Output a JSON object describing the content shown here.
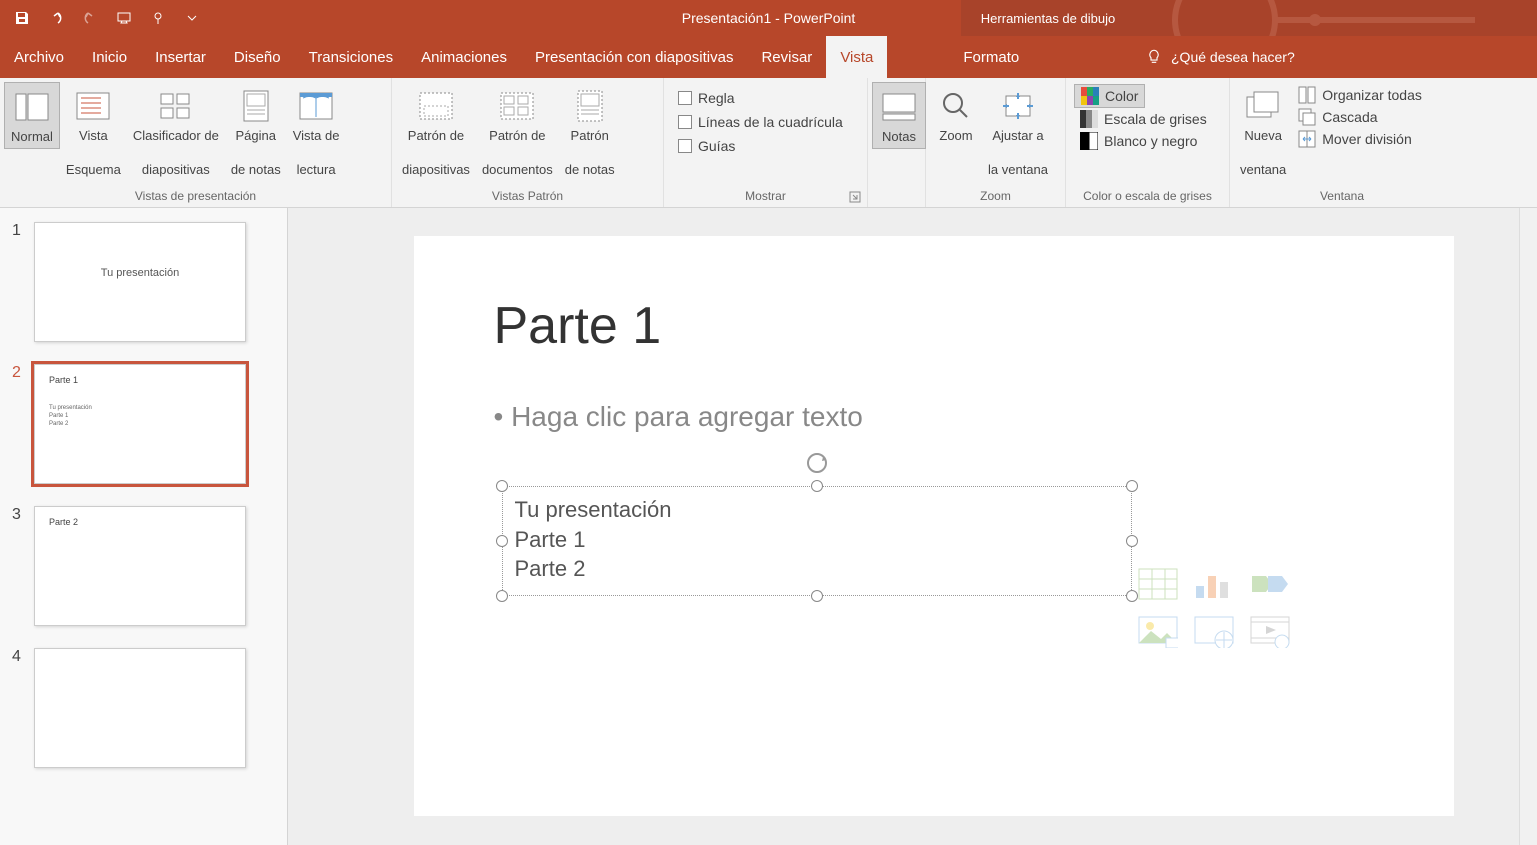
{
  "title": "Presentación1 - PowerPoint",
  "contextualTab": "Herramientas de dibujo",
  "tellMe": "¿Qué desea hacer?",
  "tabs": {
    "archivo": "Archivo",
    "inicio": "Inicio",
    "insertar": "Insertar",
    "diseno": "Diseño",
    "transiciones": "Transiciones",
    "animaciones": "Animaciones",
    "presentacion": "Presentación con diapositivas",
    "revisar": "Revisar",
    "vista": "Vista",
    "formato": "Formato"
  },
  "ribbon": {
    "vistasPresentacion": {
      "label": "Vistas de presentación",
      "normal": "Normal",
      "vistaEsquema1": "Vista",
      "vistaEsquema2": "Esquema",
      "clasificador1": "Clasificador de",
      "clasificador2": "diapositivas",
      "pagina1": "Página",
      "pagina2": "de notas",
      "vistaLectura1": "Vista de",
      "vistaLectura2": "lectura"
    },
    "vistasPatron": {
      "label": "Vistas Patrón",
      "patronDiap1": "Patrón de",
      "patronDiap2": "diapositivas",
      "patronDoc1": "Patrón de",
      "patronDoc2": "documentos",
      "patronNotas1": "Patrón",
      "patronNotas2": "de notas"
    },
    "mostrar": {
      "label": "Mostrar",
      "regla": "Regla",
      "lineas": "Líneas de la cuadrícula",
      "guias": "Guías"
    },
    "notas": "Notas",
    "zoom": {
      "label": "Zoom",
      "zoom": "Zoom",
      "ajustar1": "Ajustar a",
      "ajustar2": "la ventana"
    },
    "color": {
      "label": "Color o escala de grises",
      "color": "Color",
      "grises": "Escala de grises",
      "bn": "Blanco y negro"
    },
    "ventana": {
      "label": "Ventana",
      "nueva1": "Nueva",
      "nueva2": "ventana",
      "organizar": "Organizar todas",
      "cascada": "Cascada",
      "mover": "Mover división"
    }
  },
  "slides": {
    "one": {
      "num": "1",
      "title": "Tu presentación"
    },
    "two": {
      "num": "2",
      "title": "Parte 1",
      "line1": "Tu presentación",
      "line2": "Parte 1",
      "line3": "Parte 2"
    },
    "three": {
      "num": "3",
      "title": "Parte 2"
    },
    "four": {
      "num": "4"
    }
  },
  "canvas": {
    "title": "Parte 1",
    "placeholder": "• Haga clic para agregar texto",
    "tb1": "Tu presentación",
    "tb2": "Parte 1",
    "tb3": "Parte 2"
  }
}
